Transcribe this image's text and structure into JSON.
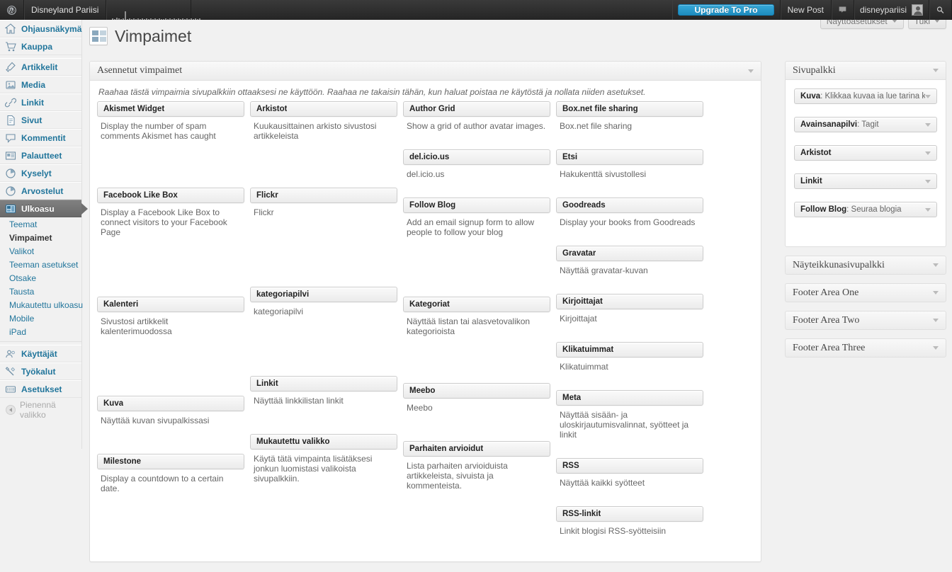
{
  "adminbar": {
    "logo_icon": "wordpress-logo-icon",
    "site_name": "Disneyland Pariisi",
    "sparkline_icon": "stats-sparkline-icon",
    "sparkline_values": [
      2,
      1,
      3,
      2,
      1,
      2,
      12,
      1,
      2,
      1,
      2,
      1,
      2,
      1,
      2,
      1,
      2,
      1,
      2,
      1,
      2,
      1,
      2,
      1,
      1,
      2,
      1,
      2,
      1,
      2,
      1,
      2,
      1,
      2,
      1,
      2,
      1,
      2,
      1,
      2,
      1,
      2
    ],
    "upgrade_label": "Upgrade To Pro",
    "new_post_label": "New Post",
    "comments_icon": "comment-bubble-icon",
    "user_name": "disneypariisi",
    "avatar_icon": "user-avatar-icon",
    "search_icon": "search-icon"
  },
  "screen_meta": {
    "screen_options_label": "Näyttöasetukset",
    "help_label": "Tuki",
    "caret_icon": "chevron-down-icon"
  },
  "sidebar": {
    "items": [
      {
        "label": "Ohjausnäkymä",
        "icon": "dashboard-icon"
      },
      {
        "label": "Kauppa",
        "icon": "cart-icon"
      },
      {
        "label": "Artikkelit",
        "icon": "pin-icon"
      },
      {
        "label": "Media",
        "icon": "media-icon"
      },
      {
        "label": "Linkit",
        "icon": "link-icon"
      },
      {
        "label": "Sivut",
        "icon": "page-icon"
      },
      {
        "label": "Kommentit",
        "icon": "comment-icon"
      },
      {
        "label": "Palautteet",
        "icon": "feedback-icon"
      },
      {
        "label": "Kyselyt",
        "icon": "polls-icon"
      },
      {
        "label": "Arvostelut",
        "icon": "ratings-icon"
      },
      {
        "label": "Ulkoasu",
        "icon": "appearance-icon",
        "current": true
      },
      {
        "label": "Käyttäjät",
        "icon": "users-icon"
      },
      {
        "label": "Työkalut",
        "icon": "tools-icon"
      },
      {
        "label": "Asetukset",
        "icon": "settings-icon"
      }
    ],
    "submenu": [
      {
        "label": "Teemat"
      },
      {
        "label": "Vimpaimet",
        "current": true
      },
      {
        "label": "Valikot"
      },
      {
        "label": "Teeman asetukset"
      },
      {
        "label": "Otsake"
      },
      {
        "label": "Tausta"
      },
      {
        "label": "Mukautettu ulkoasu"
      },
      {
        "label": "Mobile"
      },
      {
        "label": "iPad"
      }
    ],
    "collapse_label": "Pienennä valikko",
    "collapse_icon": "collapse-arrow-icon"
  },
  "page": {
    "title": "Vimpaimet",
    "title_icon": "widgets-icon"
  },
  "available_widgets": {
    "panel_title": "Asennetut vimpaimet",
    "toggle_icon": "chevron-down-icon",
    "intro": "Raahaa tästä vimpaimia sivupalkkiin ottaaksesi ne käyttöön. Raahaa ne takaisin tähän, kun haluat poistaa ne käytöstä ja nollata niiden asetukset.",
    "columns": [
      {
        "widgets": [
          {
            "name": "Akismet Widget",
            "desc": "Display the number of spam comments Akismet has caught",
            "gap": "gap-56"
          },
          {
            "name": "Facebook Like Box",
            "desc": "Display a Facebook Like Box to connect visitors to your Facebook Page",
            "gap": "gap-74"
          },
          {
            "name": "Kalenteri",
            "desc": "Sivustosi artikkelit kalenterimuodossa",
            "gap": "gap-74"
          },
          {
            "name": "Kuva",
            "desc": "Näyttää kuvan sivupalkissasi",
            "gap": "gap-30"
          },
          {
            "name": "Milestone",
            "desc": "Display a countdown to a certain date.",
            "gap": "gap-16"
          }
        ]
      },
      {
        "widgets": [
          {
            "name": "Arkistot",
            "desc": "Kuukausittainen arkisto sivustosi artikkeleista",
            "gap": "gap-56"
          },
          {
            "name": "Flickr",
            "desc": "Flickr",
            "gap": "gap-88"
          },
          {
            "name": "kategoriapilvi",
            "desc": "kategoriapilvi",
            "gap": "gap-74"
          },
          {
            "name": "Linkit",
            "desc": "Näyttää linkkilistan linkit",
            "gap": "gap-30"
          },
          {
            "name": "Mukautettu valikko",
            "desc": "Käytä tätä vimpainta lisätäksesi jonkun luomistasi valikoista sivupalkkiin.",
            "gap": "gap-16"
          }
        ]
      },
      {
        "widgets": [
          {
            "name": "Author Grid",
            "desc": "Show a grid of author avatar images.",
            "gap": "gap-16"
          },
          {
            "name": "del.icio.us",
            "desc": "del.icio.us",
            "gap": "gap-16"
          },
          {
            "name": "Follow Blog",
            "desc": "Add an email signup form to allow people to follow your blog",
            "gap": "gap-74"
          },
          {
            "name": "Kategoriat",
            "desc": "Näyttää listan tai alasvetovalikon kategorioista",
            "gap": "gap-56"
          },
          {
            "name": "Meebo",
            "desc": "Meebo",
            "gap": "gap-30"
          },
          {
            "name": "Parhaiten arvioidut",
            "desc": "Lista parhaiten arvioiduista artikkeleista, sivuista ja kommenteista.",
            "gap": "gap-16"
          }
        ]
      },
      {
        "widgets": [
          {
            "name": "Box.net file sharing",
            "desc": "Box.net file sharing",
            "gap": "gap-16"
          },
          {
            "name": "Etsi",
            "desc": "Hakukenttä sivustollesi",
            "gap": "gap-16"
          },
          {
            "name": "Goodreads",
            "desc": "Display your books from Goodreads",
            "gap": "gap-16"
          },
          {
            "name": "Gravatar",
            "desc": "Näyttää gravatar-kuvan",
            "gap": "gap-16"
          },
          {
            "name": "Kirjoittajat",
            "desc": "Kirjoittajat",
            "gap": "gap-16"
          },
          {
            "name": "Klikatuimmat",
            "desc": "Klikatuimmat",
            "gap": "gap-16"
          },
          {
            "name": "Meta",
            "desc": "Näyttää sisään- ja uloskirjautumisvalinnat, syötteet ja linkit",
            "gap": "gap-16"
          },
          {
            "name": "RSS",
            "desc": "Näyttää kaikki syötteet",
            "gap": "gap-16"
          },
          {
            "name": "RSS-linkit",
            "desc": "Linkit blogisi RSS-syötteisiin",
            "gap": "gap-16"
          }
        ]
      }
    ]
  },
  "sidebars": [
    {
      "title": "Sivupalkki",
      "open": true,
      "toggle_icon": "chevron-down-icon",
      "widgets": [
        {
          "name": "Kuva",
          "instance": ": Klikkaa kuvaa ia lue tarina k"
        },
        {
          "name": "Avainsanapilvi",
          "instance": ": Tagit"
        },
        {
          "name": "Arkistot",
          "instance": ""
        },
        {
          "name": "Linkit",
          "instance": ""
        },
        {
          "name": "Follow Blog",
          "instance": ": Seuraa blogia"
        }
      ]
    },
    {
      "title": "Näyteikkunasivupalkki",
      "open": false,
      "toggle_icon": "chevron-down-icon",
      "widgets": []
    },
    {
      "title": "Footer Area One",
      "open": false,
      "toggle_icon": "chevron-down-icon",
      "widgets": []
    },
    {
      "title": "Footer Area Two",
      "open": false,
      "toggle_icon": "chevron-down-icon",
      "widgets": []
    },
    {
      "title": "Footer Area Three",
      "open": false,
      "toggle_icon": "chevron-down-icon",
      "widgets": []
    }
  ],
  "colors": {
    "accent": "#21759b",
    "adminbar_bg": "#2b2b2b",
    "upgrade_button": "#1e8cbe",
    "page_bg": "#f1f1f1"
  }
}
